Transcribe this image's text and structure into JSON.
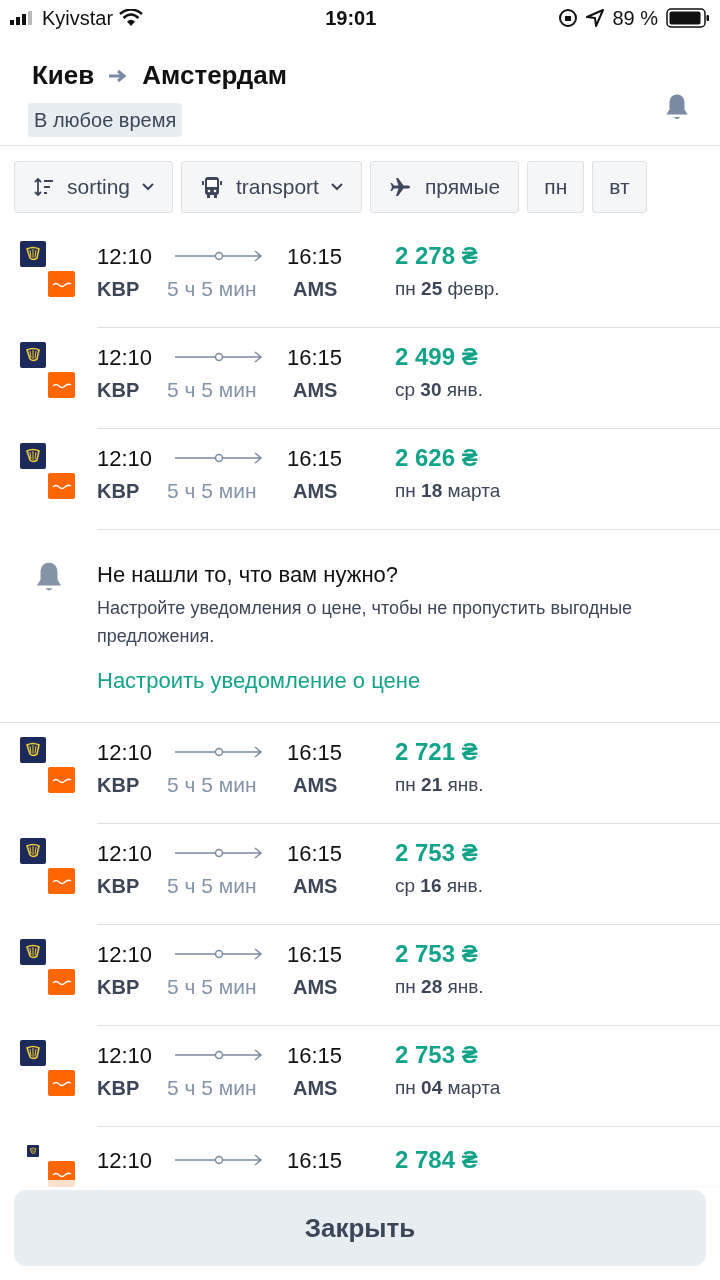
{
  "status_bar": {
    "carrier": "Kyivstar",
    "time": "19:01",
    "battery": "89 %"
  },
  "header": {
    "from": "Киев",
    "to": "Амстердам",
    "period": "В любое время"
  },
  "filters": [
    {
      "kind": "sort",
      "label": "sorting"
    },
    {
      "kind": "transport",
      "label": "transport"
    },
    {
      "kind": "direct",
      "label": "прямые"
    },
    {
      "kind": "day",
      "label": "пн"
    },
    {
      "kind": "day",
      "label": "вт"
    }
  ],
  "results": [
    {
      "kind": "flight",
      "depart": "12:10",
      "arrive": "16:15",
      "from": "KBP",
      "to": "AMS",
      "duration": "5 ч 5 мин",
      "price": "2 278 ₴",
      "date": "пн **25** февр."
    },
    {
      "kind": "flight",
      "depart": "12:10",
      "arrive": "16:15",
      "from": "KBP",
      "to": "AMS",
      "duration": "5 ч 5 мин",
      "price": "2 499 ₴",
      "date": "ср **30** янв."
    },
    {
      "kind": "flight",
      "depart": "12:10",
      "arrive": "16:15",
      "from": "KBP",
      "to": "AMS",
      "duration": "5 ч 5 мин",
      "price": "2 626 ₴",
      "date": "пн **18** марта"
    },
    {
      "kind": "promo",
      "title": "Не нашли то, что вам нужно?",
      "text": "Настройте уведомления о цене, чтобы не пропустить выгодные предложения.",
      "link": "Настроить уведомление о цене"
    },
    {
      "kind": "flight",
      "depart": "12:10",
      "arrive": "16:15",
      "from": "KBP",
      "to": "AMS",
      "duration": "5 ч 5 мин",
      "price": "2 721 ₴",
      "date": "пн **21** янв."
    },
    {
      "kind": "flight",
      "depart": "12:10",
      "arrive": "16:15",
      "from": "KBP",
      "to": "AMS",
      "duration": "5 ч 5 мин",
      "price": "2 753 ₴",
      "date": "ср **16** янв."
    },
    {
      "kind": "flight",
      "depart": "12:10",
      "arrive": "16:15",
      "from": "KBP",
      "to": "AMS",
      "duration": "5 ч 5 мин",
      "price": "2 753 ₴",
      "date": "пн **28** янв."
    },
    {
      "kind": "flight",
      "depart": "12:10",
      "arrive": "16:15",
      "from": "KBP",
      "to": "AMS",
      "duration": "5 ч 5 мин",
      "price": "2 753 ₴",
      "date": "пн **04** марта"
    },
    {
      "kind": "flight_partial",
      "depart": "12:10",
      "arrive": "16:15",
      "price": "2 784 ₴"
    }
  ],
  "close_button": "Закрыть"
}
